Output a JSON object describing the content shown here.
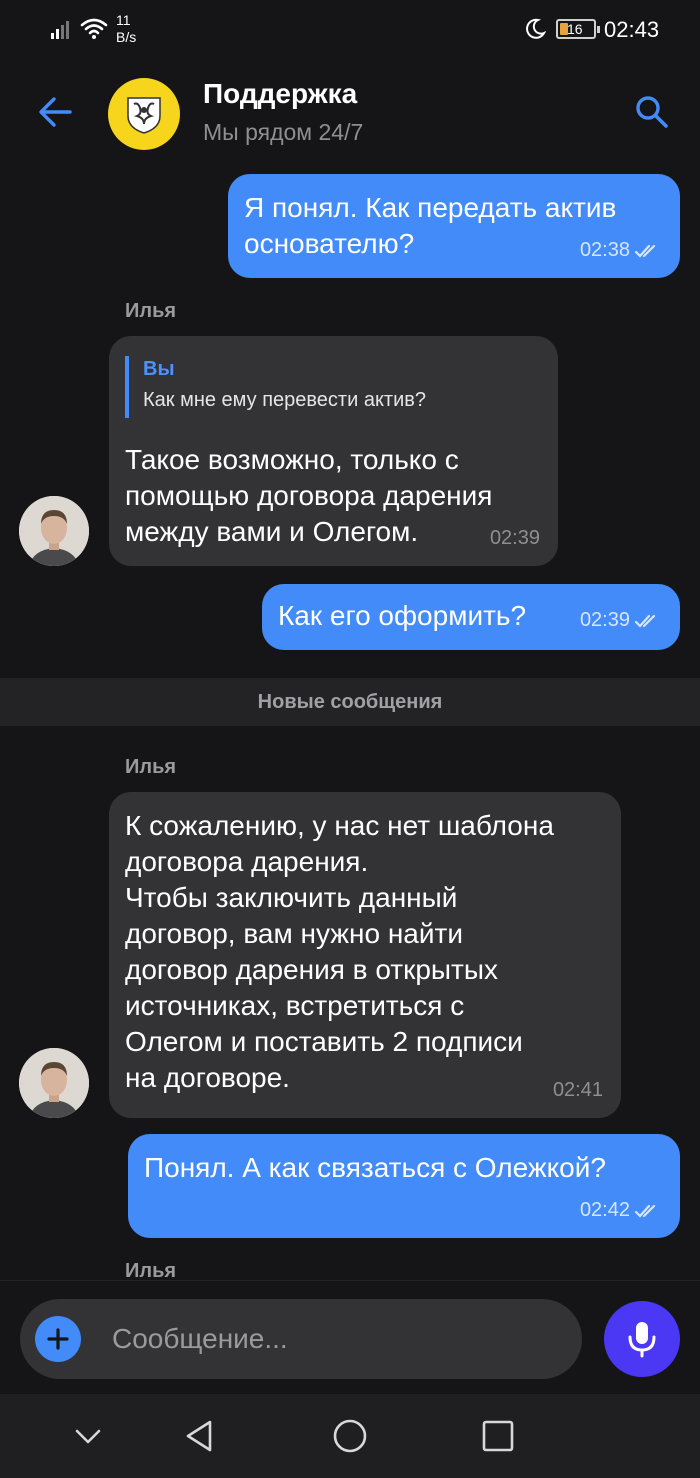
{
  "status_bar": {
    "speed_value": "11",
    "speed_unit": "B/s",
    "battery": "16",
    "time": "02:43"
  },
  "header": {
    "title": "Поддержка",
    "subtitle": "Мы рядом 24/7"
  },
  "messages": [
    {
      "direction": "out",
      "text": "Я понял. Как передать актив\nоснователю?",
      "time": "02:38"
    },
    {
      "direction": "in",
      "sender": "Илья",
      "reply_author": "Вы",
      "reply_text": "Как мне ему перевести актив?",
      "text": "Такое возможно, только с\nпомощью договора дарения\nмежду вами и Олегом.",
      "time": "02:39"
    },
    {
      "direction": "out",
      "text": "Как его оформить?",
      "time": "02:39"
    },
    {
      "direction": "in",
      "sender": "Илья",
      "text": "К сожалению, у нас нет шаблона\nдоговора дарения.\nЧтобы заключить данный\nдоговор, вам нужно найти\nдоговор дарения в открытых\nисточниках, встретиться с\nОлегом и поставить 2 подписи\nна договоре.",
      "time": "02:41"
    },
    {
      "direction": "out",
      "text": "Понял. А как связаться с Олежкой?",
      "time": "02:42"
    },
    {
      "direction": "in",
      "sender": "Илья"
    }
  ],
  "divider": "Новые сообщения",
  "input": {
    "placeholder": "Сообщение..."
  },
  "colors": {
    "background": "#151517",
    "outgoing_bubble": "#428bf9",
    "incoming_bubble": "#333335",
    "accent": "#428bf9",
    "mic_button": "#4b38f5",
    "logo": "#f7d51d"
  },
  "icons": [
    "signal-icon",
    "wifi-icon",
    "moon-icon",
    "battery-icon",
    "back-arrow-icon",
    "search-icon",
    "double-check-icon",
    "plus-icon",
    "microphone-icon",
    "nav-down-icon",
    "nav-back-icon",
    "nav-home-icon",
    "nav-recents-icon"
  ]
}
